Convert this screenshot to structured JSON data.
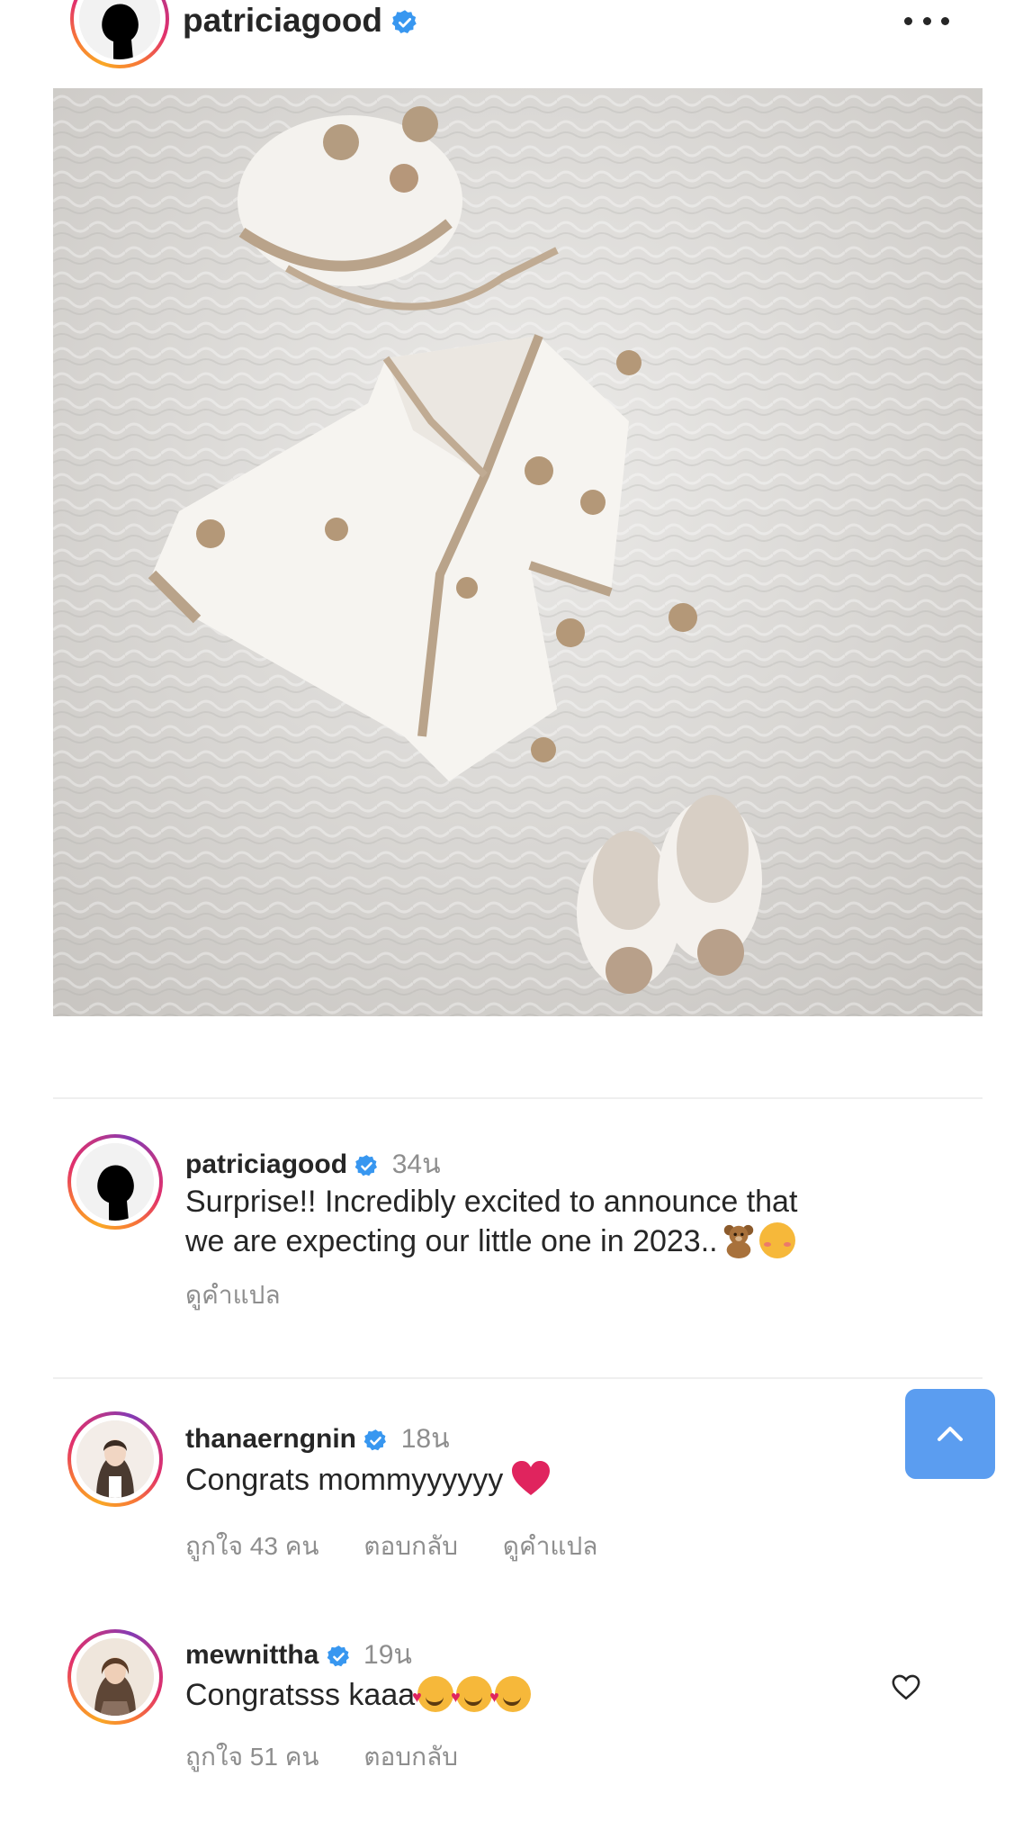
{
  "post": {
    "username": "patriciagood",
    "more_icon": "more-horizontal-icon"
  },
  "comments": [
    {
      "username": "patriciagood",
      "time": "34น",
      "text_line1": "Surprise!! Incredibly excited to announce that",
      "text_line2": "we are expecting our little one in 2023..",
      "see_translation": "ดูคำแปล"
    },
    {
      "username": "thanaerngnin",
      "time": "18น",
      "text": "Congrats mommyyyyyy",
      "likes": "ถูกใจ 43 คน",
      "reply": "ตอบกลับ",
      "see_translation": "ดูคำแปล"
    },
    {
      "username": "mewnittha",
      "time": "19น",
      "text": "Congratsss kaaa",
      "likes": "ถูกใจ 51 คน",
      "reply": "ตอบกลับ"
    }
  ],
  "colors": {
    "verified": "#3897f0",
    "scroll_button": "#5b9df0",
    "heart": "#e0245e"
  }
}
